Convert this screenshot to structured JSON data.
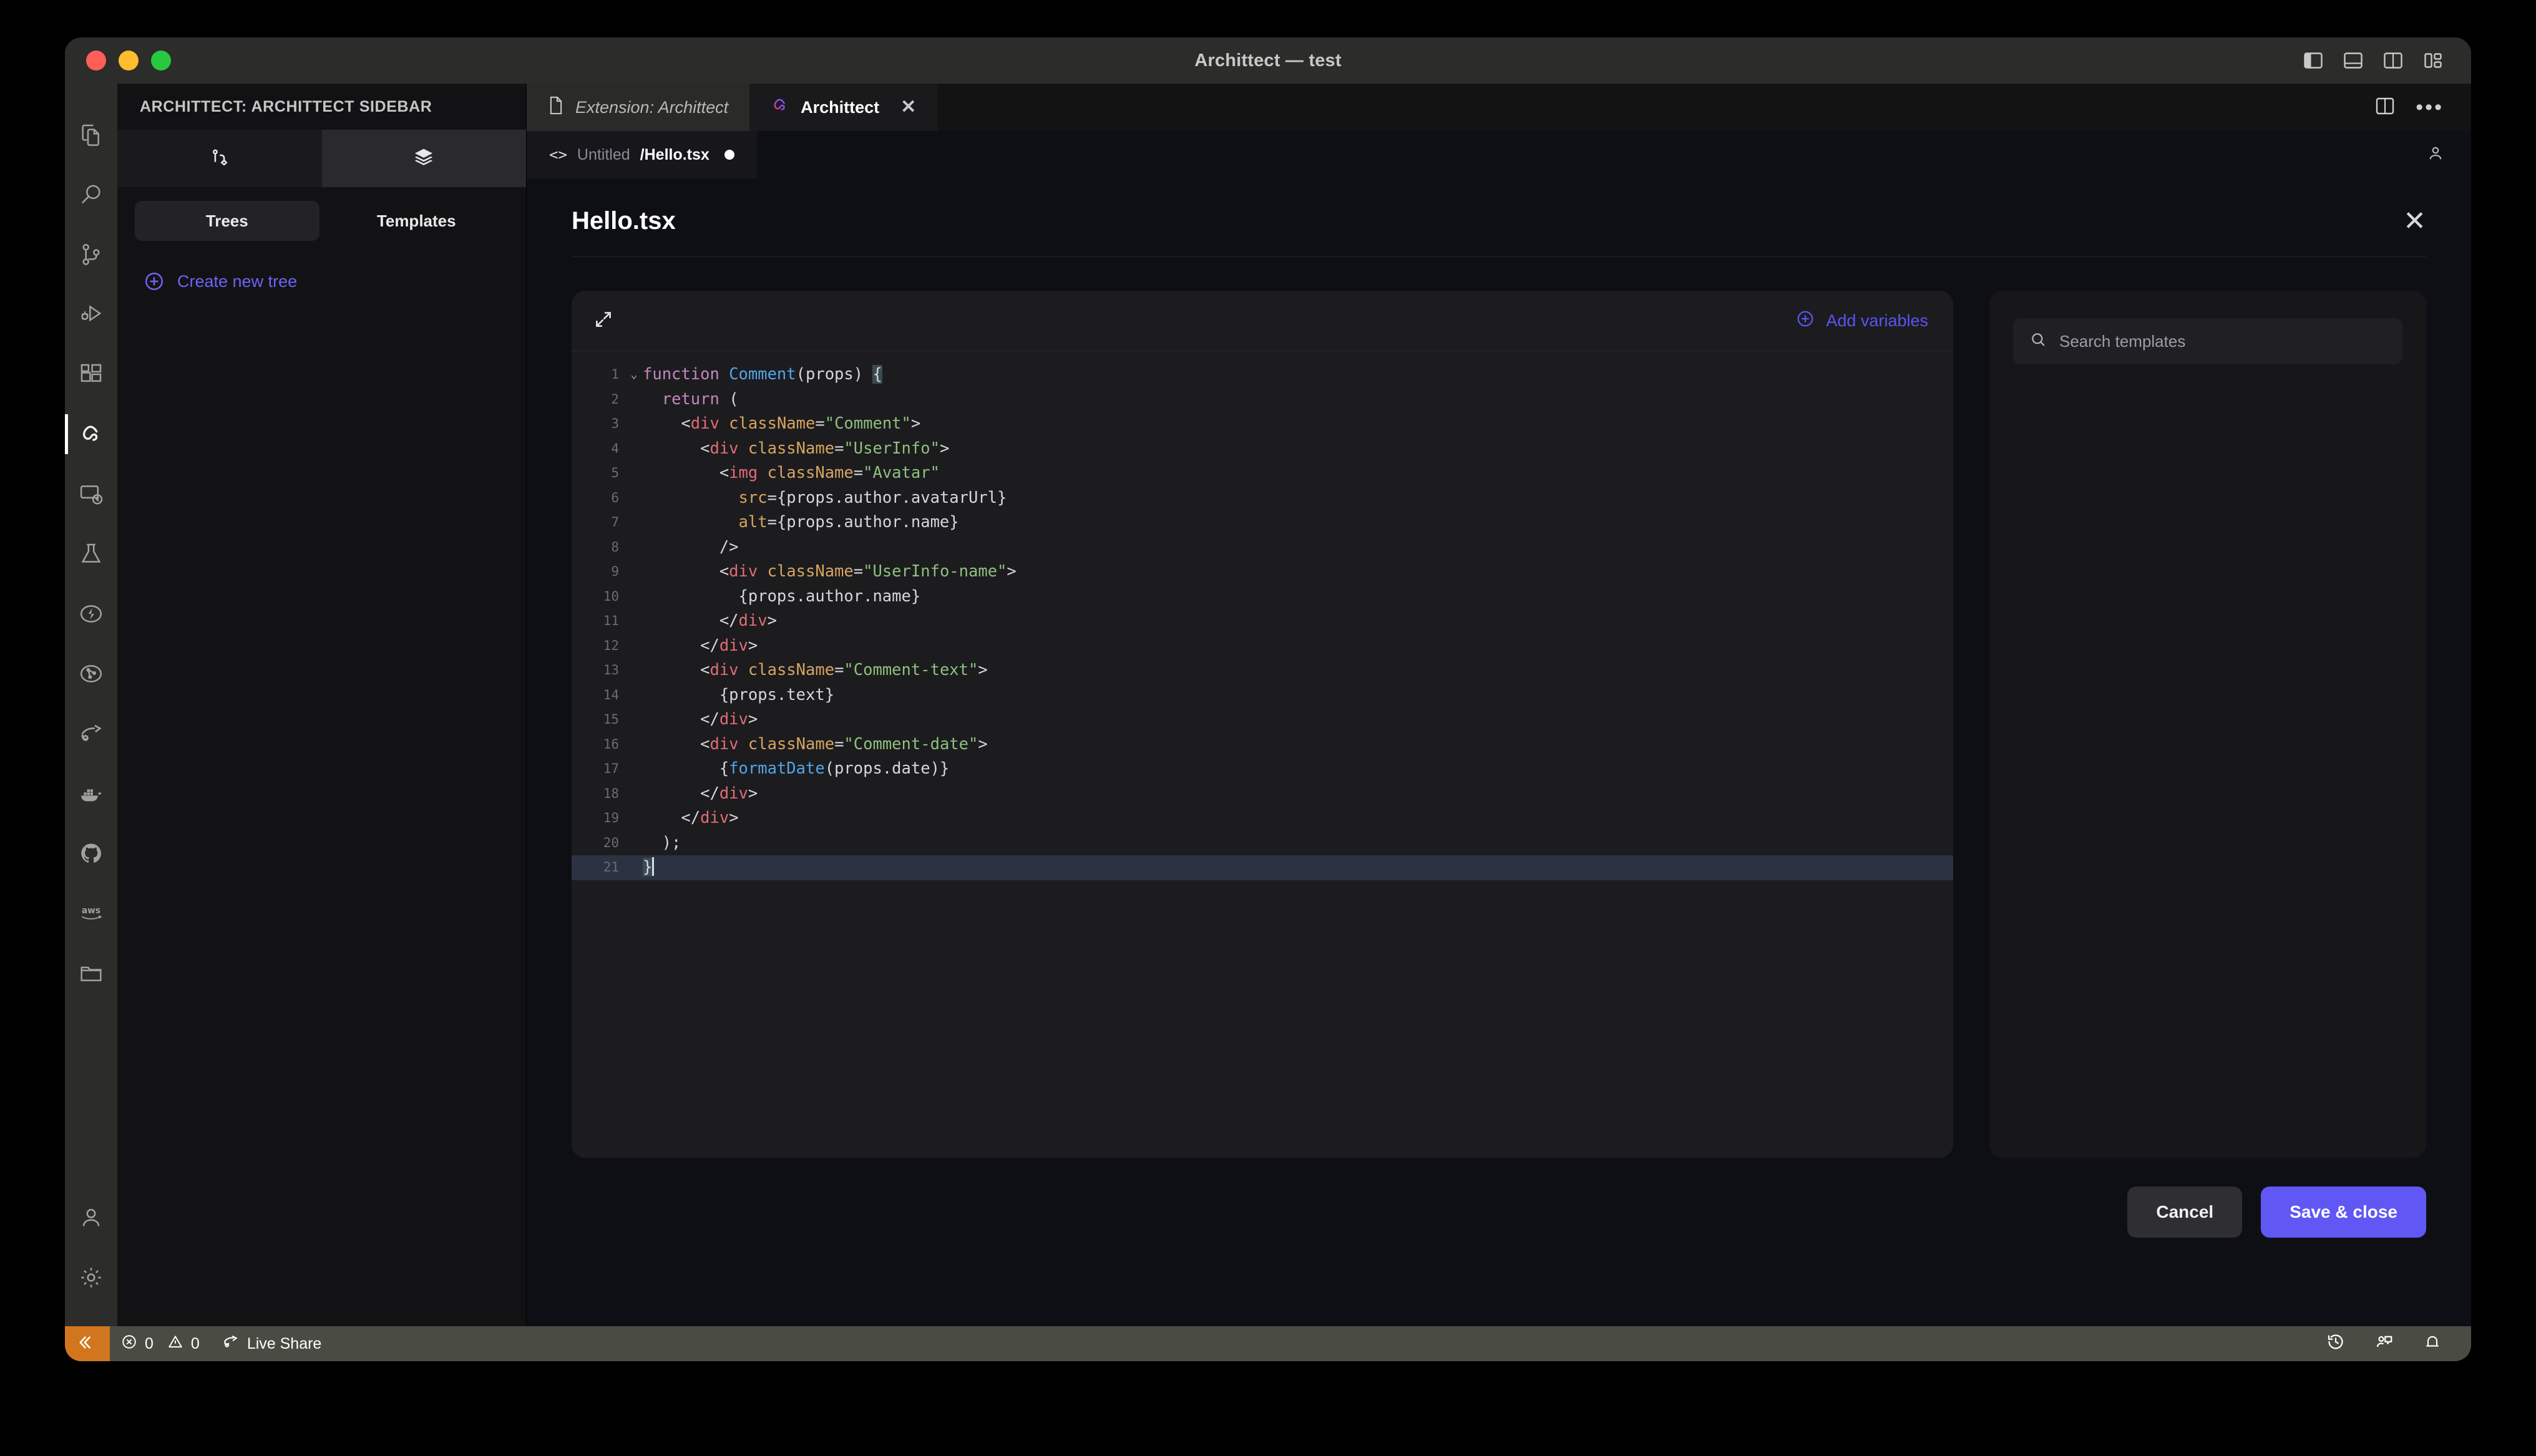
{
  "window": {
    "title": "Archittect — test",
    "traffic_lights": [
      "close",
      "minimize",
      "zoom"
    ],
    "layout_icons": [
      "toggle-primary-sidebar",
      "toggle-panel",
      "toggle-secondary-sidebar",
      "customize-layout"
    ]
  },
  "activitybar": {
    "items": [
      {
        "name": "explorer",
        "icon": "files-icon",
        "active": false
      },
      {
        "name": "search",
        "icon": "search-icon",
        "active": false
      },
      {
        "name": "source-control",
        "icon": "source-control-icon",
        "active": false
      },
      {
        "name": "run-and-debug",
        "icon": "run-debug-icon",
        "active": false
      },
      {
        "name": "extensions",
        "icon": "extensions-icon",
        "active": false
      },
      {
        "name": "archittect",
        "icon": "archittect-logo-icon",
        "active": true
      },
      {
        "name": "remote-explorer",
        "icon": "remote-window-icon",
        "active": false
      },
      {
        "name": "testing",
        "icon": "flask-icon",
        "active": false
      },
      {
        "name": "thunder-client",
        "icon": "thunder-bolt-icon",
        "active": false
      },
      {
        "name": "graph",
        "icon": "graph-circle-icon",
        "active": false
      },
      {
        "name": "live-share",
        "icon": "live-share-icon",
        "active": false
      },
      {
        "name": "docker",
        "icon": "docker-whale-icon",
        "active": false
      },
      {
        "name": "github",
        "icon": "github-icon",
        "active": false
      },
      {
        "name": "aws-toolkit",
        "icon": "aws-icon",
        "active": false
      },
      {
        "name": "file-manager",
        "icon": "folder-icon",
        "active": false
      }
    ],
    "bottom_items": [
      {
        "name": "accounts",
        "icon": "account-icon"
      },
      {
        "name": "settings",
        "icon": "gear-icon"
      }
    ]
  },
  "sidebar": {
    "header": "ARCHITTECT: ARCHITTECT SIDEBAR",
    "view_icons": [
      {
        "name": "tree-view",
        "icon": "branch-icon",
        "selected": false
      },
      {
        "name": "templates-view",
        "icon": "layers-icon",
        "selected": true
      }
    ],
    "segments": [
      {
        "label": "Trees",
        "active": true
      },
      {
        "label": "Templates",
        "active": false
      }
    ],
    "create_action": {
      "label": "Create new tree",
      "icon": "plus-circle-icon",
      "color": "#6c63f5"
    }
  },
  "editor": {
    "tabs": [
      {
        "label": "Extension: Archittect",
        "icon": "file-icon",
        "active": false,
        "closable": false,
        "italic": true
      },
      {
        "label": "Archittect",
        "icon": "archittect-logo-icon",
        "active": true,
        "closable": true,
        "close_label": "✕"
      }
    ],
    "tab_actions": [
      {
        "name": "split-editor",
        "icon": "split-editor-icon"
      },
      {
        "name": "more-actions",
        "icon": "ellipsis-icon",
        "label": "•••"
      }
    ],
    "breadcrumb": {
      "icon": "code-brackets-icon",
      "icon_label": "<>",
      "folder": "Untitled",
      "file": "/Hello.tsx",
      "dirty": true
    },
    "breadcrumb_right_icon": "account-icon"
  },
  "panel": {
    "title": "Hello.tsx",
    "close_label": "✕",
    "card": {
      "expand_icon": "expand-arrows-icon",
      "add_variables_label": "Add variables",
      "add_variables_icon": "plus-circle-icon",
      "accent": "#5b54f0"
    },
    "templates": {
      "search_placeholder": "Search templates",
      "search_icon": "search-icon",
      "search_value": ""
    },
    "actions": [
      {
        "label": "Cancel",
        "style": "secondary"
      },
      {
        "label": "Save & close",
        "style": "primary",
        "color": "#6157f5"
      }
    ]
  },
  "code": {
    "language": "tsx",
    "highlighted_line": 21,
    "lines": [
      {
        "n": 1,
        "fold": "⌄",
        "tokens": [
          {
            "t": "function ",
            "c": "kw"
          },
          {
            "t": "Comment",
            "c": "fn"
          },
          {
            "t": "(props) ",
            "c": "plain"
          },
          {
            "t": "{",
            "c": "bracket"
          }
        ]
      },
      {
        "n": 2,
        "fold": "",
        "tokens": [
          {
            "t": "  ",
            "c": "plain"
          },
          {
            "t": "return",
            "c": "kw"
          },
          {
            "t": " (",
            "c": "plain"
          }
        ]
      },
      {
        "n": 3,
        "fold": "",
        "tokens": [
          {
            "t": "    <",
            "c": "punc"
          },
          {
            "t": "div",
            "c": "tag"
          },
          {
            "t": " className",
            "c": "attr"
          },
          {
            "t": "=",
            "c": "punc"
          },
          {
            "t": "\"Comment\"",
            "c": "str"
          },
          {
            "t": ">",
            "c": "punc"
          }
        ]
      },
      {
        "n": 4,
        "fold": "",
        "tokens": [
          {
            "t": "      <",
            "c": "punc"
          },
          {
            "t": "div",
            "c": "tag"
          },
          {
            "t": " className",
            "c": "attr"
          },
          {
            "t": "=",
            "c": "punc"
          },
          {
            "t": "\"UserInfo\"",
            "c": "str"
          },
          {
            "t": ">",
            "c": "punc"
          }
        ]
      },
      {
        "n": 5,
        "fold": "",
        "tokens": [
          {
            "t": "        <",
            "c": "punc"
          },
          {
            "t": "img",
            "c": "tag"
          },
          {
            "t": " className",
            "c": "attr"
          },
          {
            "t": "=",
            "c": "punc"
          },
          {
            "t": "\"Avatar\"",
            "c": "str"
          }
        ]
      },
      {
        "n": 6,
        "fold": "",
        "tokens": [
          {
            "t": "          ",
            "c": "plain"
          },
          {
            "t": "src",
            "c": "attr"
          },
          {
            "t": "={props.author.avatarUrl}",
            "c": "plain"
          }
        ]
      },
      {
        "n": 7,
        "fold": "",
        "tokens": [
          {
            "t": "          ",
            "c": "plain"
          },
          {
            "t": "alt",
            "c": "attr"
          },
          {
            "t": "={props.author.name}",
            "c": "plain"
          }
        ]
      },
      {
        "n": 8,
        "fold": "",
        "tokens": [
          {
            "t": "        />",
            "c": "punc"
          }
        ]
      },
      {
        "n": 9,
        "fold": "",
        "tokens": [
          {
            "t": "        <",
            "c": "punc"
          },
          {
            "t": "div",
            "c": "tag"
          },
          {
            "t": " className",
            "c": "attr"
          },
          {
            "t": "=",
            "c": "punc"
          },
          {
            "t": "\"UserInfo-name\"",
            "c": "str"
          },
          {
            "t": ">",
            "c": "punc"
          }
        ]
      },
      {
        "n": 10,
        "fold": "",
        "tokens": [
          {
            "t": "          {props.author.name}",
            "c": "plain"
          }
        ]
      },
      {
        "n": 11,
        "fold": "",
        "tokens": [
          {
            "t": "        </",
            "c": "punc"
          },
          {
            "t": "div",
            "c": "tag"
          },
          {
            "t": ">",
            "c": "punc"
          }
        ]
      },
      {
        "n": 12,
        "fold": "",
        "tokens": [
          {
            "t": "      </",
            "c": "punc"
          },
          {
            "t": "div",
            "c": "tag"
          },
          {
            "t": ">",
            "c": "punc"
          }
        ]
      },
      {
        "n": 13,
        "fold": "",
        "tokens": [
          {
            "t": "      <",
            "c": "punc"
          },
          {
            "t": "div",
            "c": "tag"
          },
          {
            "t": " className",
            "c": "attr"
          },
          {
            "t": "=",
            "c": "punc"
          },
          {
            "t": "\"Comment-text\"",
            "c": "str"
          },
          {
            "t": ">",
            "c": "punc"
          }
        ]
      },
      {
        "n": 14,
        "fold": "",
        "tokens": [
          {
            "t": "        {props.text}",
            "c": "plain"
          }
        ]
      },
      {
        "n": 15,
        "fold": "",
        "tokens": [
          {
            "t": "      </",
            "c": "punc"
          },
          {
            "t": "div",
            "c": "tag"
          },
          {
            "t": ">",
            "c": "punc"
          }
        ]
      },
      {
        "n": 16,
        "fold": "",
        "tokens": [
          {
            "t": "      <",
            "c": "punc"
          },
          {
            "t": "div",
            "c": "tag"
          },
          {
            "t": " className",
            "c": "attr"
          },
          {
            "t": "=",
            "c": "punc"
          },
          {
            "t": "\"Comment-date\"",
            "c": "str"
          },
          {
            "t": ">",
            "c": "punc"
          }
        ]
      },
      {
        "n": 17,
        "fold": "",
        "tokens": [
          {
            "t": "        {",
            "c": "plain"
          },
          {
            "t": "formatDate",
            "c": "fn"
          },
          {
            "t": "(props.date)}",
            "c": "plain"
          }
        ]
      },
      {
        "n": 18,
        "fold": "",
        "tokens": [
          {
            "t": "      </",
            "c": "punc"
          },
          {
            "t": "div",
            "c": "tag"
          },
          {
            "t": ">",
            "c": "punc"
          }
        ]
      },
      {
        "n": 19,
        "fold": "",
        "tokens": [
          {
            "t": "    </",
            "c": "punc"
          },
          {
            "t": "div",
            "c": "tag"
          },
          {
            "t": ">",
            "c": "punc"
          }
        ]
      },
      {
        "n": 20,
        "fold": "",
        "tokens": [
          {
            "t": "  );",
            "c": "plain"
          }
        ]
      },
      {
        "n": 21,
        "fold": "",
        "tokens": [
          {
            "t": "}",
            "c": "bracket"
          },
          {
            "t": "",
            "c": "caret"
          }
        ]
      }
    ]
  },
  "statusbar": {
    "remote_icon": "remote-indicator-icon",
    "items": [
      {
        "name": "problems",
        "error_icon": "error-circle-icon",
        "errors": "0",
        "warning_icon": "warning-triangle-icon",
        "warnings": "0"
      },
      {
        "name": "live-share",
        "icon": "live-share-icon",
        "label": "Live Share"
      }
    ],
    "right_items": [
      {
        "name": "timeline",
        "icon": "history-icon"
      },
      {
        "name": "feedback",
        "icon": "feedback-icon"
      },
      {
        "name": "notifications",
        "icon": "bell-icon"
      }
    ]
  }
}
